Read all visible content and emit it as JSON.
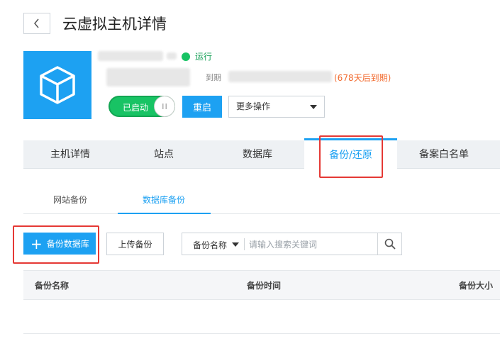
{
  "header": {
    "title": "云虚拟主机详情"
  },
  "host": {
    "status": "运行",
    "expire_label": "到期",
    "expire_days": "(678天后到期)",
    "power_toggle_label": "已启动",
    "restart_label": "重启",
    "more_actions_label": "更多操作"
  },
  "tabs": [
    {
      "label": "主机详情"
    },
    {
      "label": "站点"
    },
    {
      "label": "数据库"
    },
    {
      "label": "备份/还原"
    },
    {
      "label": "备案白名单"
    }
  ],
  "subtabs": [
    {
      "label": "网站备份"
    },
    {
      "label": "数据库备份"
    }
  ],
  "toolbar": {
    "add_db_backup_label": "备份数据库",
    "upload_backup_label": "上传备份",
    "search_field": "备份名称",
    "search_placeholder": "请输入搜索关键词"
  },
  "table": {
    "columns": [
      "备份名称",
      "备份时间",
      "备份大小"
    ]
  },
  "colors": {
    "accent": "#1da1f2",
    "running": "#18c364",
    "highlight": "#e53935",
    "expire": "#f26a2e"
  }
}
